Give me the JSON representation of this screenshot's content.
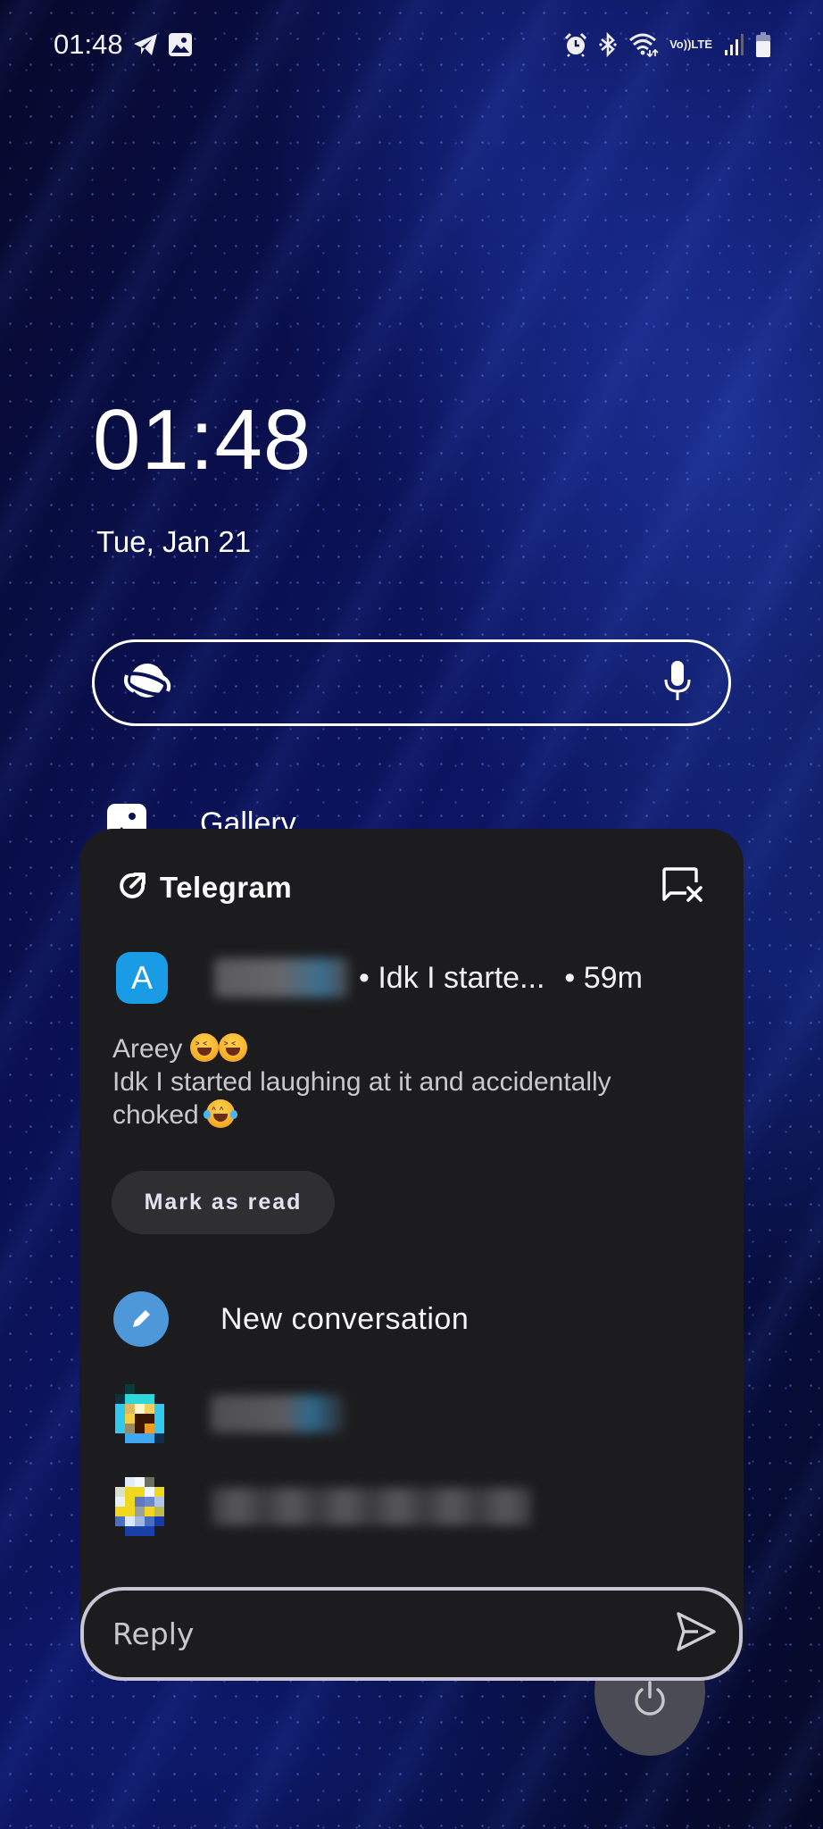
{
  "status_bar": {
    "time": "01:48",
    "left_icons": [
      "telegram-icon",
      "gallery-notification-icon"
    ],
    "right_icons": [
      "alarm-icon",
      "bluetooth-icon",
      "wifi-icon",
      "volte-icon",
      "signal-icon",
      "battery-icon"
    ],
    "volte_line1": "Vo))",
    "volte_line2": "LTE"
  },
  "lockscreen": {
    "clock": "01:48",
    "date": "Tue, Jan 21"
  },
  "search_bar": {
    "left_icon": "browser-planet-icon",
    "right_icon": "microphone-icon",
    "placeholder": ""
  },
  "shortcut": {
    "icon": "gallery-icon",
    "label": "Gallery"
  },
  "notification": {
    "app_name": "Telegram",
    "app_icon": "open-external-icon",
    "dismiss_icon": "dismiss-chat-icon",
    "sender_avatar_letter": "A",
    "sender_name_blurred": true,
    "preview": "• Idk I starte...",
    "time": "• 59m",
    "message_line1": "Areey",
    "message_line2": "Idk I started laughing at it and accidentally",
    "message_line3": "choked",
    "emojis": [
      "laughing-squint-emoji",
      "laughing-squint-emoji",
      "tears-of-joy-emoji"
    ],
    "mark_as_read_label": "Mark as read",
    "new_conversation_label": "New conversation",
    "contacts": [
      {
        "name_blurred": true,
        "avatar": "pixel-avatar-1"
      },
      {
        "name_blurred": true,
        "avatar": "pixel-avatar-2"
      }
    ],
    "reply_placeholder": "Reply",
    "reply_value": ""
  },
  "colors": {
    "card_bg": "#1c1c1e",
    "avatar_blue": "#1a9be6",
    "pencil_blue": "#4e97d9",
    "mark_read_bg": "#2f2f31",
    "reply_border": "#c8c6d6",
    "power_bg": "#4a4b55"
  }
}
